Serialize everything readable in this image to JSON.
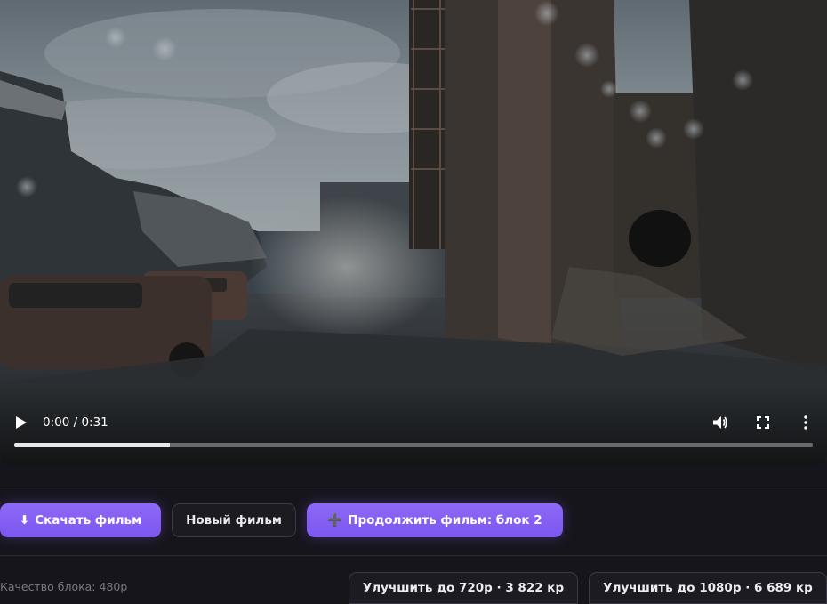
{
  "player": {
    "time_display": "0:00 / 0:31",
    "progress_fraction": 0.195,
    "icons": {
      "play": "play-icon",
      "volume": "volume-icon",
      "fullscreen": "fullscreen-icon",
      "menu": "more-vertical-icon"
    }
  },
  "actions": {
    "download_label": "Скачать фильм",
    "download_icon": "⬇",
    "new_film_label": "Новый фильм",
    "continue_label": "Продолжить фильм: блок 2",
    "continue_icon": "➕"
  },
  "quality": {
    "label": "Качество блока: 480p",
    "upgrade_720": "Улучшить до 720p · 3 822 кр",
    "upgrade_1080": "Улучшить до 1080p · 6 689 кр"
  },
  "colors": {
    "accent": "#8b66f5",
    "background": "#17151c"
  }
}
